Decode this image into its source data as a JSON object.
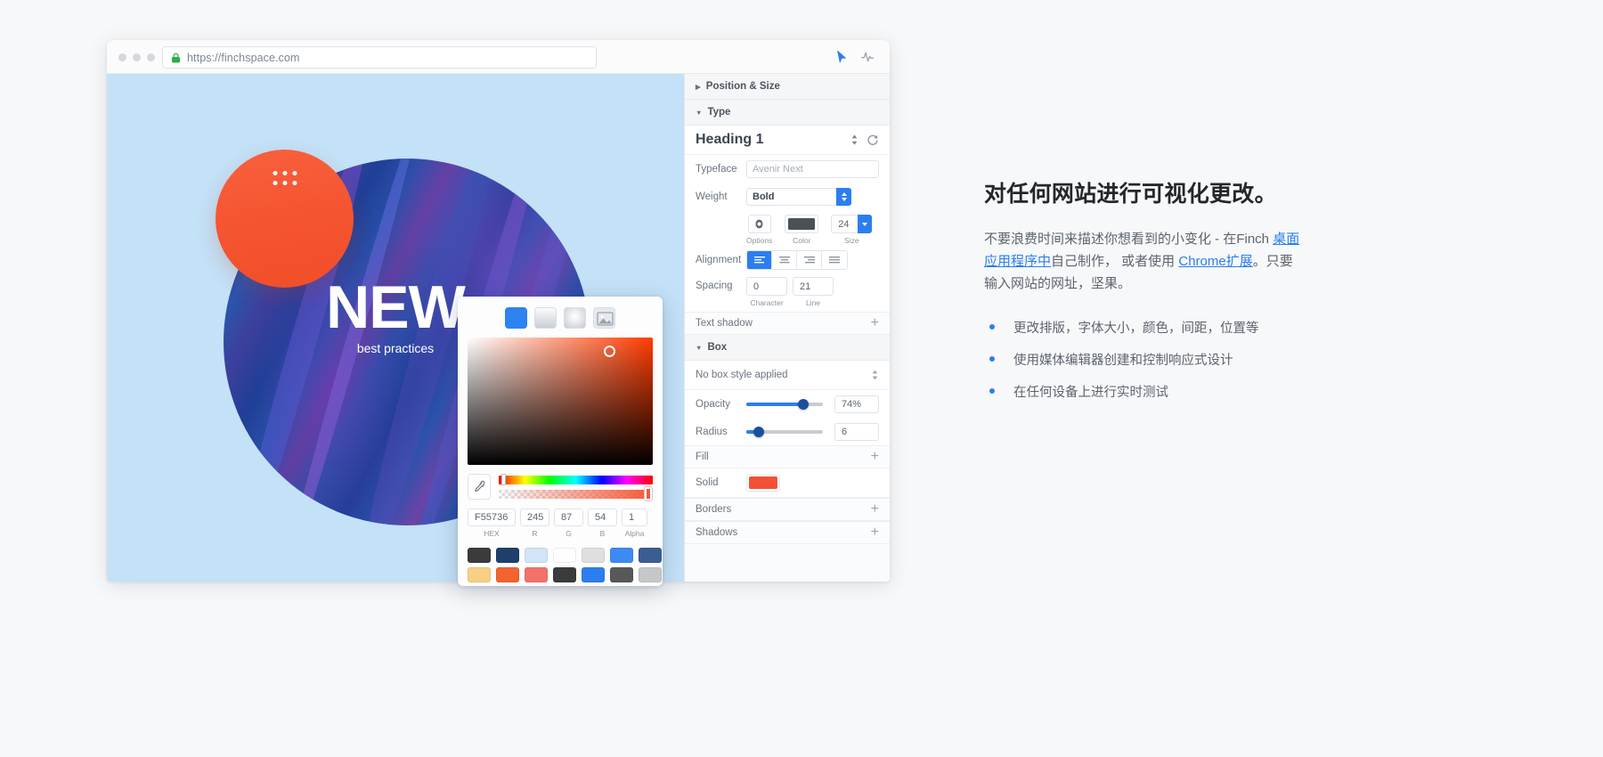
{
  "browser": {
    "url": "https://finchspace.com",
    "lock_icon": "lock-icon",
    "traffic_lights": [
      "close",
      "minimize",
      "maximize"
    ],
    "tools": [
      {
        "name": "pointer-tool",
        "icon": "cursor-arrow-icon"
      },
      {
        "name": "inspect-tool",
        "icon": "activity-pulse-icon"
      }
    ]
  },
  "canvas": {
    "headline": "NEW",
    "subhead": "best practices",
    "orange_shape_color": "#F4542F",
    "drag_handle_icon": "grid-dots-icon",
    "background_color": "#C3E1F7"
  },
  "inspector": {
    "sections": [
      {
        "label": "Position & Size",
        "expanded": false,
        "caret": "▶"
      },
      {
        "label": "Type",
        "expanded": true,
        "caret": "▼"
      }
    ],
    "heading": {
      "name": "Heading 1",
      "stepper_icon": "stepper-updown-icon",
      "reset_icon": "refresh-icon"
    },
    "type": {
      "typeface_label": "Typeface",
      "typeface_value": "Avenir Next",
      "typeface_placeholder": "Avenir Next",
      "weight_label": "Weight",
      "weight_value": "Bold",
      "options_caption": "Options",
      "options_icon": "gear-icon",
      "color_caption": "Color",
      "color_value": "#4B5157",
      "size_caption": "Size",
      "size_value": "24",
      "alignment_label": "Alignment",
      "alignment_options": [
        "align-left",
        "align-center",
        "align-right",
        "align-justify"
      ],
      "alignment_selected": 0,
      "spacing_label": "Spacing",
      "spacing_character": "0",
      "spacing_character_caption": "Character",
      "spacing_line": "21",
      "spacing_line_caption": "Line"
    },
    "text_shadow": {
      "label": "Text shadow",
      "add_icon": "+"
    },
    "box_section": {
      "label": "Box",
      "caret": "▼"
    },
    "box": {
      "style_value": "No box style applied",
      "style_stepper_icon": "stepper-updown-icon",
      "opacity_label": "Opacity",
      "opacity_value": "74%",
      "opacity_percent": 74,
      "radius_label": "Radius",
      "radius_value": "6",
      "radius_percent": 16
    },
    "fill": {
      "label": "Fill",
      "add_icon": "+",
      "solid_label": "Solid",
      "solid_color": "#F25138"
    },
    "borders": {
      "label": "Borders",
      "add_icon": "+"
    },
    "shadows": {
      "label": "Shadows",
      "add_icon": "+"
    },
    "accent_color": "#2C7EF0"
  },
  "color_picker": {
    "tabs": [
      {
        "name": "solid-fill-tab",
        "selected": true
      },
      {
        "name": "linear-gradient-tab",
        "selected": false
      },
      {
        "name": "radial-gradient-tab",
        "selected": false
      },
      {
        "name": "image-fill-tab",
        "selected": false,
        "icon": "image-icon"
      }
    ],
    "eyedropper_icon": "eyedropper-icon",
    "hex_value": "F55736",
    "hex_caption": "HEX",
    "r_value": "245",
    "r_caption": "R",
    "g_value": "87",
    "g_caption": "G",
    "b_value": "54",
    "b_caption": "B",
    "alpha_value": "1",
    "alpha_caption": "Alpha",
    "swatches": [
      "#3A3B3D",
      "#1E3F6B",
      "#D2E4F6",
      "#FEFEFE",
      "#DEDFE0",
      "#3D8BF2",
      "#3A5D93",
      "#2768DA",
      "#F8CF84",
      "#F2632E",
      "#F2726A",
      "#3A3B3D",
      "#2C7EF0",
      "#575858",
      "#C6C7C8",
      "#4BE3B0"
    ]
  },
  "marketing": {
    "title": "对任何网站进行可视化更改。",
    "body_part_1": "不要浪费时间来描述你想看到的小变化 - 在Finch ",
    "body_link_1": "桌面应用程序中",
    "body_part_2": "自己制作， 或者使用 ",
    "body_link_2": "Chrome扩展",
    "body_part_3": "。只要输入网站的网址，坚果。",
    "bullets": [
      "更改排版，字体大小，颜色，间距，位置等",
      "使用媒体编辑器创建和控制响应式设计",
      "在任何设备上进行实时测试"
    ],
    "link_color": "#2C7EF0"
  }
}
